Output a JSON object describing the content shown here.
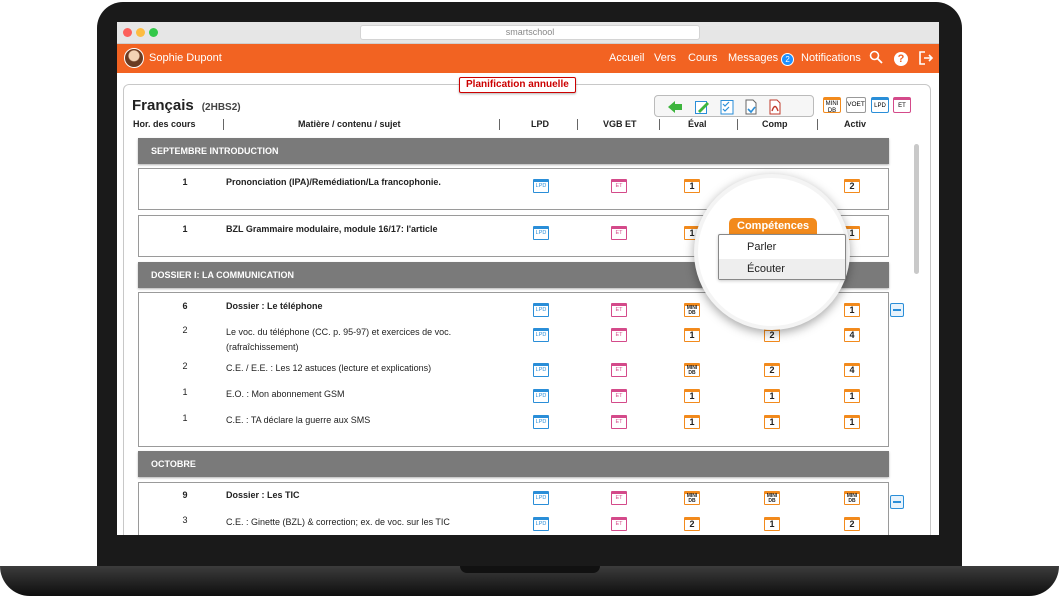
{
  "browser": {
    "url": "smartschool"
  },
  "nav": {
    "user_name": "Sophie Dupont",
    "items": [
      "Accueil",
      "Vers",
      "Cours",
      "Messages",
      "Notifications"
    ],
    "messages_count": "2",
    "help_label": "?",
    "icons": [
      "search-icon",
      "help-icon",
      "logout-icon"
    ]
  },
  "page": {
    "tag": "Planification annuelle",
    "title": "Français",
    "code": "(2HBS2)"
  },
  "toolbar": {
    "icons": [
      "back-arrow-icon",
      "edit-icon",
      "checklist-icon",
      "word-doc-icon",
      "pdf-icon"
    ],
    "labels": {
      "mini_db": "MINI DB",
      "voet": "VOET",
      "lpd": "LPD",
      "et": "ET"
    }
  },
  "columns": {
    "hours": "Hor. des cours",
    "subject": "Matière / contenu / sujet",
    "lpd": "LPD",
    "vgb": "VGB ET",
    "eval": "Éval",
    "comp": "Comp",
    "activ": "Activ"
  },
  "sections": [
    {
      "title": "SEPTEMBRE INTRODUCTION"
    },
    {
      "title": "DOSSIER I: LA COMMUNICATION"
    },
    {
      "title": "OCTOBRE"
    }
  ],
  "rows": {
    "r1": {
      "hrs": "1",
      "subj": "Prononciation (IPA)/Remédiation/La francophonie.",
      "eval": "1",
      "activ": "2"
    },
    "r2": {
      "hrs": "1",
      "subj": "BZL Grammaire modulaire, module 16/17: l'article",
      "eval": "1",
      "activ": "1"
    },
    "r3": {
      "hrs": "6",
      "subj": "Dossier : Le téléphone",
      "activ": "1"
    },
    "r4": {
      "hrs": "2",
      "subj": "Le voc. du téléphone (CC. p. 95-97) et exercices de voc. (rafraîchissement)",
      "eval": "1",
      "comp": "2",
      "activ": "4"
    },
    "r5": {
      "hrs": "2",
      "subj": "C.E. / E.E. : Les 12 astuces (lecture et explications)",
      "comp": "2",
      "activ": "4"
    },
    "r6": {
      "hrs": "1",
      "subj": "E.O. : Mon abonnement GSM",
      "eval": "1",
      "comp": "1",
      "activ": "1"
    },
    "r7": {
      "hrs": "1",
      "subj": "C.E. : TA déclare la guerre aux SMS",
      "eval": "1",
      "comp": "1",
      "activ": "1"
    },
    "r8": {
      "hrs": "9",
      "subj": "Dossier : Les TIC"
    },
    "r9": {
      "hrs": "3",
      "subj": "C.E. : Ginette (BZL) & correction; ex. de voc. sur les TIC",
      "eval": "2",
      "comp": "1",
      "activ": "2"
    }
  },
  "icon_labels": {
    "lpd": "LPD",
    "et": "ET",
    "mini_db": "MINI DB"
  },
  "competences": {
    "tab": "Compétences",
    "options": [
      "Parler",
      "Écouter"
    ]
  },
  "colors": {
    "brand": "#f26322",
    "lpd": "#2a8ed8",
    "et": "#d44a8a",
    "num": "#f28a1c",
    "section": "#7a7a7a"
  }
}
